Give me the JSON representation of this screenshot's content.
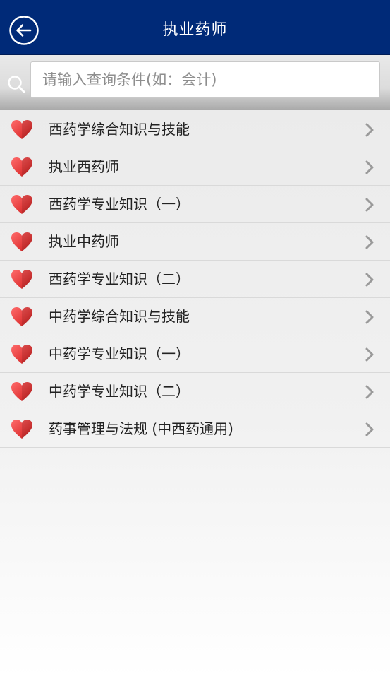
{
  "header": {
    "title": "执业药师",
    "back_icon": "back-arrow-icon",
    "background_color": "#002a78"
  },
  "search": {
    "placeholder": "请输入查询条件(如：会计)",
    "value": "",
    "icon": "search-icon"
  },
  "list": {
    "item_icon": "heart-icon",
    "item_icon_color": "#e63b3b",
    "trailing_icon": "chevron-right-icon",
    "items": [
      {
        "label": "西药学综合知识与技能"
      },
      {
        "label": "执业西药师"
      },
      {
        "label": "西药学专业知识（一）"
      },
      {
        "label": "执业中药师"
      },
      {
        "label": "西药学专业知识（二）"
      },
      {
        "label": "中药学综合知识与技能"
      },
      {
        "label": "中药学专业知识（一）"
      },
      {
        "label": "中药学专业知识（二）"
      },
      {
        "label": "药事管理与法规 (中西药通用)"
      }
    ]
  }
}
